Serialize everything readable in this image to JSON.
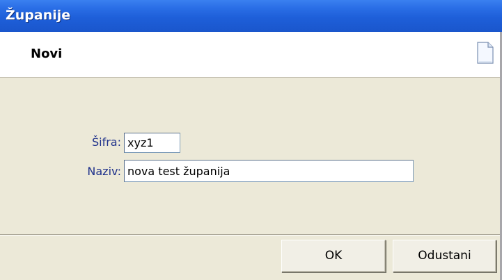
{
  "window": {
    "title": "Županije"
  },
  "header": {
    "title": "Novi",
    "icon": "document-icon"
  },
  "form": {
    "sifra": {
      "label": "Šifra:",
      "value": "xyz1"
    },
    "naziv": {
      "label": "Naziv:",
      "value": "nova test županija"
    }
  },
  "buttons": {
    "ok_label": "OK",
    "cancel_label": "Odustani"
  },
  "colors": {
    "titlebar": "#1e5fd9",
    "label_text": "#1c2f8a",
    "panel": "#ece9d8"
  }
}
